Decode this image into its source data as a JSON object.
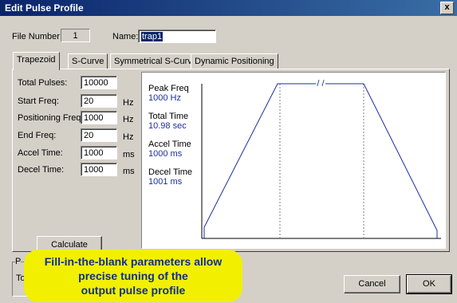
{
  "window": {
    "title": "Edit Pulse Profile",
    "close_label": "x"
  },
  "header": {
    "file_number_label": "File Number:",
    "file_number_value": "1",
    "name_label": "Name:",
    "name_value": "trap1"
  },
  "tabs": [
    {
      "label": "Trapezoid",
      "active": true
    },
    {
      "label": "S-Curve",
      "active": false
    },
    {
      "label": "Symmetrical S-Curve",
      "active": false
    },
    {
      "label": "Dynamic Positioning",
      "active": false
    }
  ],
  "params": [
    {
      "label": "Total Pulses:",
      "value": "10000",
      "unit": ""
    },
    {
      "label": "Start Freq:",
      "value": "20",
      "unit": "Hz"
    },
    {
      "label": "Positioning Freq:",
      "value": "1000",
      "unit": "Hz"
    },
    {
      "label": "End Freq:",
      "value": "20",
      "unit": "Hz"
    },
    {
      "label": "Accel Time:",
      "value": "1000",
      "unit": "ms"
    },
    {
      "label": "Decel Time:",
      "value": "1000",
      "unit": "ms"
    }
  ],
  "calculate_button": "Calculate Profile",
  "info": [
    {
      "label": "Peak Freq",
      "value": "1000 Hz"
    },
    {
      "label": "Total Time",
      "value": "10.98 sec"
    },
    {
      "label": "Accel Time",
      "value": "1000 ms"
    },
    {
      "label": "Decel Time",
      "value": "1001 ms"
    }
  ],
  "profile_graph": {
    "break_marker": "/ /",
    "line_color": "#1a2f9c"
  },
  "bottom": {
    "group_label_partial": "P",
    "text_partial": "To"
  },
  "buttons": {
    "cancel": "Cancel",
    "ok": "OK"
  },
  "callout": {
    "lines": [
      "Fill-in-the-blank parameters allow",
      "precise tuning of the",
      "output pulse profile"
    ],
    "background": "#f2f000",
    "text_color": "#0e2f8c"
  }
}
